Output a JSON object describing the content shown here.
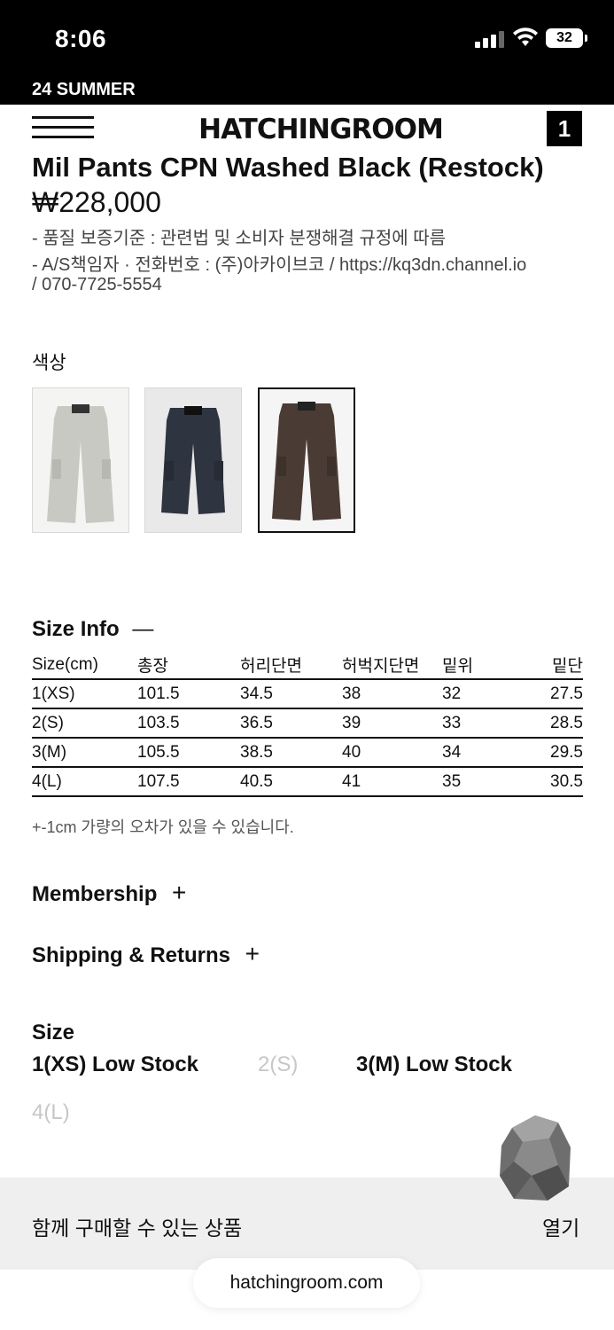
{
  "status_bar": {
    "time": "8:06",
    "battery": "32"
  },
  "banner": {
    "text": "24 SUMMER"
  },
  "header": {
    "logo": "HATCHINGROOM",
    "cart_count": "1"
  },
  "product": {
    "title": "Mil Pants CPN Washed Black (Restock)",
    "price": "₩228,000",
    "info_lines": [
      "- 품질 보증기준 : 관련법 및 소비자 분쟁해결 규정에 따름",
      "- A/S책임자 · 전화번호 : (주)아카이브코 / https://kq3dn.channel.io",
      "/ 070-7725-5554"
    ]
  },
  "colors": {
    "label": "색상",
    "swatches": [
      {
        "name": "light-grey",
        "color": "#c9c9c4",
        "selected": false
      },
      {
        "name": "navy",
        "color": "#2e3440",
        "selected": false
      },
      {
        "name": "brown",
        "color": "#4a3b34",
        "selected": true
      }
    ]
  },
  "size_info": {
    "title": "Size Info",
    "toggle": "—",
    "headers": [
      "Size(cm)",
      "총장",
      "허리단면",
      "허벅지단면",
      "밑위",
      "밑단"
    ],
    "rows": [
      [
        "1(XS)",
        "101.5",
        "34.5",
        "38",
        "32",
        "27.5"
      ],
      [
        "2(S)",
        "103.5",
        "36.5",
        "39",
        "33",
        "28.5"
      ],
      [
        "3(M)",
        "105.5",
        "38.5",
        "40",
        "34",
        "29.5"
      ],
      [
        "4(L)",
        "107.5",
        "40.5",
        "41",
        "35",
        "30.5"
      ]
    ],
    "note": "+-1cm 가량의 오차가 있을 수 있습니다."
  },
  "membership": {
    "title": "Membership",
    "toggle": "+"
  },
  "shipping": {
    "title": "Shipping & Returns",
    "toggle": "+"
  },
  "size_select": {
    "label": "Size",
    "options": [
      {
        "label": "1(XS) Low Stock",
        "available": true
      },
      {
        "label": "2(S)",
        "available": false
      },
      {
        "label": "3(M) Low Stock",
        "available": true
      },
      {
        "label": "4(L)",
        "available": false
      }
    ]
  },
  "related": {
    "label": "함께 구매할 수 있는 상품",
    "open": "열기"
  },
  "browser": {
    "url": "hatchingroom.com"
  }
}
